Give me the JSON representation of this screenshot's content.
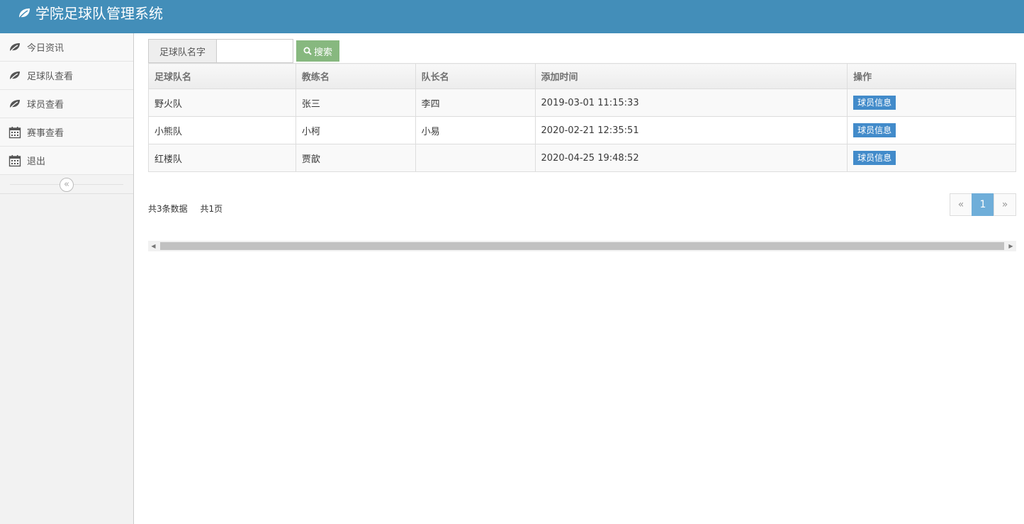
{
  "header": {
    "title": "学院足球队管理系统",
    "icon": "leaf-icon"
  },
  "sidebar": {
    "items": [
      {
        "label": "今日资讯",
        "icon": "leaf-icon"
      },
      {
        "label": "足球队查看",
        "icon": "leaf-icon"
      },
      {
        "label": "球员查看",
        "icon": "leaf-icon"
      },
      {
        "label": "赛事查看",
        "icon": "calendar-icon"
      },
      {
        "label": "退出",
        "icon": "calendar-icon"
      }
    ],
    "collapse_glyph": "«"
  },
  "search": {
    "label": "足球队名字",
    "value": "",
    "placeholder": "",
    "button_label": "搜索"
  },
  "table": {
    "headers": [
      "足球队名",
      "教练名",
      "队长名",
      "添加时间",
      "操作"
    ],
    "rows": [
      {
        "team": "野火队",
        "coach": "张三",
        "captain": "李四",
        "time": "2019-03-01 11:15:33",
        "action": "球员信息"
      },
      {
        "team": "小熊队",
        "coach": "小柯",
        "captain": "小易",
        "time": "2020-02-21 12:35:51",
        "action": "球员信息"
      },
      {
        "team": "红楼队",
        "coach": "贾歆",
        "captain": "",
        "time": "2020-04-25 19:48:52",
        "action": "球员信息"
      }
    ]
  },
  "footer": {
    "total_records": "共3条数据",
    "total_pages": "共1页"
  },
  "pagination": {
    "prev": "«",
    "current": "1",
    "next": "»"
  },
  "colors": {
    "header_bg": "#438eb9",
    "search_button": "#87b87f",
    "info_button": "#428bca",
    "page_active": "#6faed9"
  }
}
